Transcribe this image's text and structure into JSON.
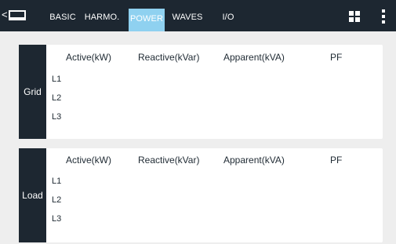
{
  "toolbar": {
    "back_glyph": "<",
    "screen_icon": "monitor-icon",
    "tabs": [
      {
        "label": "BASIC",
        "active": false
      },
      {
        "label": "HARMO.",
        "active": false
      },
      {
        "label": "POWER",
        "active": true
      },
      {
        "label": "WAVES",
        "active": false
      },
      {
        "label": "I/O",
        "active": false
      }
    ],
    "grid_icon": "grid-icon",
    "more_icon": "more-vertical-icon"
  },
  "panels": [
    {
      "label": "Grid",
      "columns": [
        "Active(kW)",
        "Reactive(kVar)",
        "Apparent(kVA)",
        "PF"
      ],
      "rows": [
        "L1",
        "L2",
        "L3"
      ]
    },
    {
      "label": "Load",
      "columns": [
        "Active(kW)",
        "Reactive(kVar)",
        "Apparent(kVA)",
        "PF"
      ],
      "rows": [
        "L1",
        "L2",
        "L3"
      ]
    }
  ],
  "colors": {
    "topbar_bg": "#1d2731",
    "active_tab_bg": "#8fd1f0",
    "panel_bg": "#ffffff",
    "page_bg": "#eeeeee"
  }
}
